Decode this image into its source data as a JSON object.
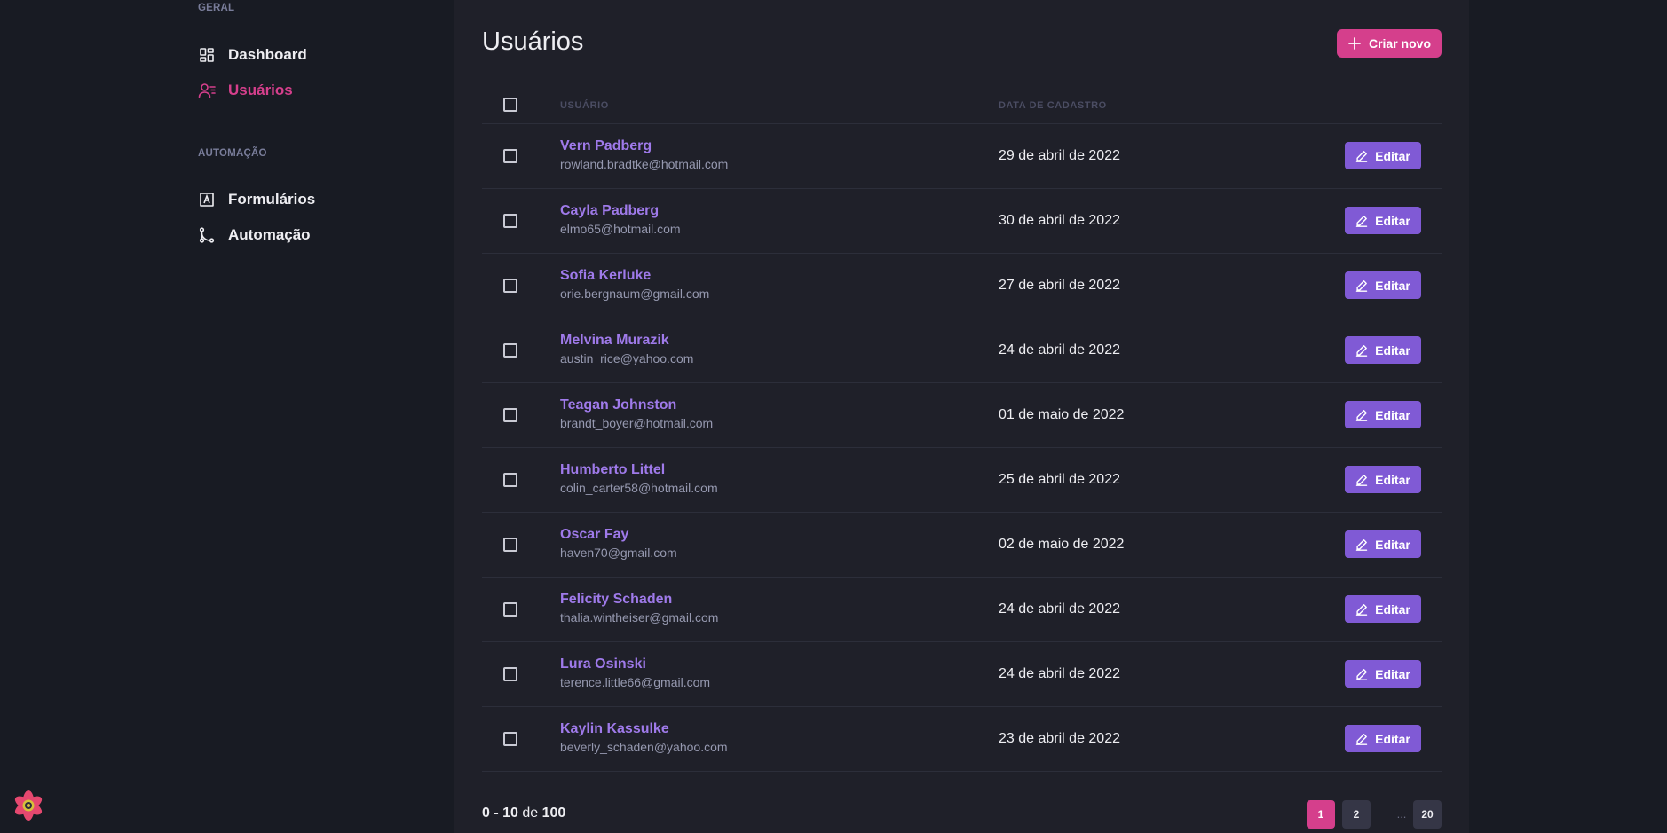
{
  "sidebar": {
    "sections": [
      {
        "title": "GERAL",
        "items": [
          {
            "label": "Dashboard",
            "icon": "dashboard-icon",
            "active": false
          },
          {
            "label": "Usuários",
            "icon": "users-icon",
            "active": true
          }
        ]
      },
      {
        "title": "AUTOMAÇÃO",
        "items": [
          {
            "label": "Formulários",
            "icon": "form-icon",
            "active": false
          },
          {
            "label": "Automação",
            "icon": "git-branch-icon",
            "active": false
          }
        ]
      }
    ]
  },
  "main": {
    "title": "Usuários",
    "create_label": "Criar novo",
    "columns": [
      "USUÁRIO",
      "DATA DE CADASTRO"
    ],
    "edit_label": "Editar",
    "rows": [
      {
        "name": "Vern Padberg",
        "email": "rowland.bradtke@hotmail.com",
        "date": "29 de abril de 2022"
      },
      {
        "name": "Cayla Padberg",
        "email": "elmo65@hotmail.com",
        "date": "30 de abril de 2022"
      },
      {
        "name": "Sofia Kerluke",
        "email": "orie.bergnaum@gmail.com",
        "date": "27 de abril de 2022"
      },
      {
        "name": "Melvina Murazik",
        "email": "austin_rice@yahoo.com",
        "date": "24 de abril de 2022"
      },
      {
        "name": "Teagan Johnston",
        "email": "brandt_boyer@hotmail.com",
        "date": "01 de maio de 2022"
      },
      {
        "name": "Humberto Littel",
        "email": "colin_carter58@hotmail.com",
        "date": "25 de abril de 2022"
      },
      {
        "name": "Oscar Fay",
        "email": "haven70@gmail.com",
        "date": "02 de maio de 2022"
      },
      {
        "name": "Felicity Schaden",
        "email": "thalia.wintheiser@gmail.com",
        "date": "24 de abril de 2022"
      },
      {
        "name": "Lura Osinski",
        "email": "terence.little66@gmail.com",
        "date": "24 de abril de 2022"
      },
      {
        "name": "Kaylin Kassulke",
        "email": "beverly_schaden@yahoo.com",
        "date": "23 de abril de 2022"
      }
    ]
  },
  "pagination": {
    "range_start": "0",
    "range_end": "10",
    "range_sep": " - ",
    "of_label": " de ",
    "total": "100",
    "pages": [
      "1",
      "2",
      "20"
    ],
    "current": "1",
    "ellipsis": "..."
  },
  "colors": {
    "accent_pink": "#d53f8c",
    "accent_purple": "#805ad5",
    "link_purple": "#9f7aea",
    "background": "#181b23",
    "panel": "#1f2029"
  },
  "logo": {
    "icon": "react-logo-icon"
  }
}
